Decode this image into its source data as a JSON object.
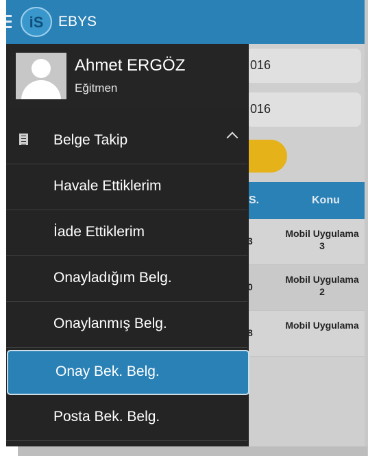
{
  "app": {
    "title": "EBYS",
    "logo_text": "iS"
  },
  "background": {
    "dates": [
      "016",
      "016"
    ],
    "table": {
      "headers": [
        "S.",
        "Konu"
      ],
      "rows": [
        {
          "num": "3",
          "subject": "Mobil Uygulama 3"
        },
        {
          "num": "0",
          "subject": "Mobil Uygulama 2"
        },
        {
          "num": "8",
          "subject": "Mobil Uygulama"
        }
      ]
    }
  },
  "drawer": {
    "user": {
      "name": "Ahmet ERGÖZ",
      "role": "Eğitmen"
    },
    "section": {
      "label": "Belge Takip",
      "expanded": true
    },
    "items": [
      {
        "label": "Havale Ettiklerim",
        "active": false
      },
      {
        "label": "İade Ettiklerim",
        "active": false
      },
      {
        "label": "Onayladığım Belg.",
        "active": false
      },
      {
        "label": "Onaylanmış Belg.",
        "active": false
      },
      {
        "label": "Onay Bek. Belg.",
        "active": true
      },
      {
        "label": "Posta Bek. Belg.",
        "active": false
      }
    ]
  },
  "colors": {
    "primary": "#2a81b6",
    "accent": "#e6b21a",
    "drawer_bg": "#242424"
  }
}
